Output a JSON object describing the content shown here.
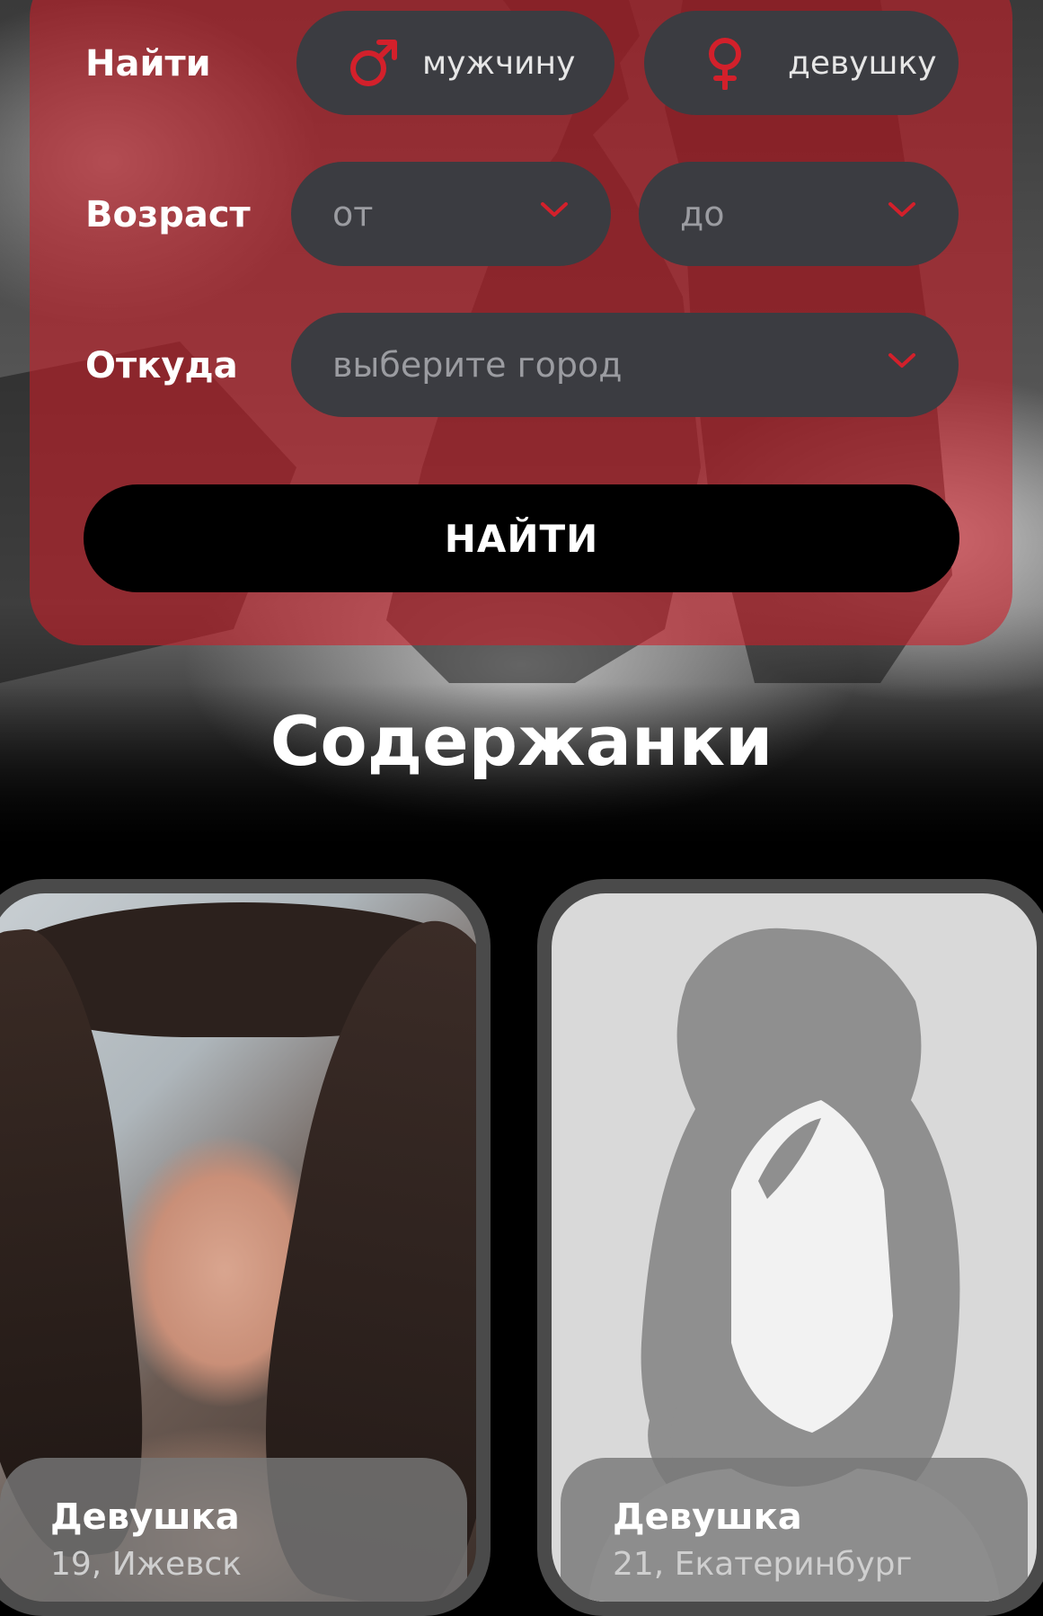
{
  "search_form": {
    "find_label": "Найти",
    "gender_options": [
      {
        "label": "мужчину",
        "icon": "male-symbol-icon"
      },
      {
        "label": "девушку",
        "icon": "female-symbol-icon"
      }
    ],
    "age_label": "Возраст",
    "age_from_placeholder": "от",
    "age_to_placeholder": "до",
    "city_label": "Откуда",
    "city_placeholder": "выберите город",
    "submit_label": "НАЙТИ"
  },
  "section": {
    "title": "Содержанки"
  },
  "profiles": [
    {
      "title": "Девушка",
      "subtitle": "19, Ижевск",
      "photo": "profile-photo"
    },
    {
      "title": "Девушка",
      "subtitle": "21, Екатеринбург",
      "photo": "avatar-placeholder-icon"
    }
  ],
  "colors": {
    "accent_red": "#d3202b",
    "panel_red": "#cd1e28",
    "pill_dark": "#3b3c41",
    "button_black": "#000000"
  }
}
